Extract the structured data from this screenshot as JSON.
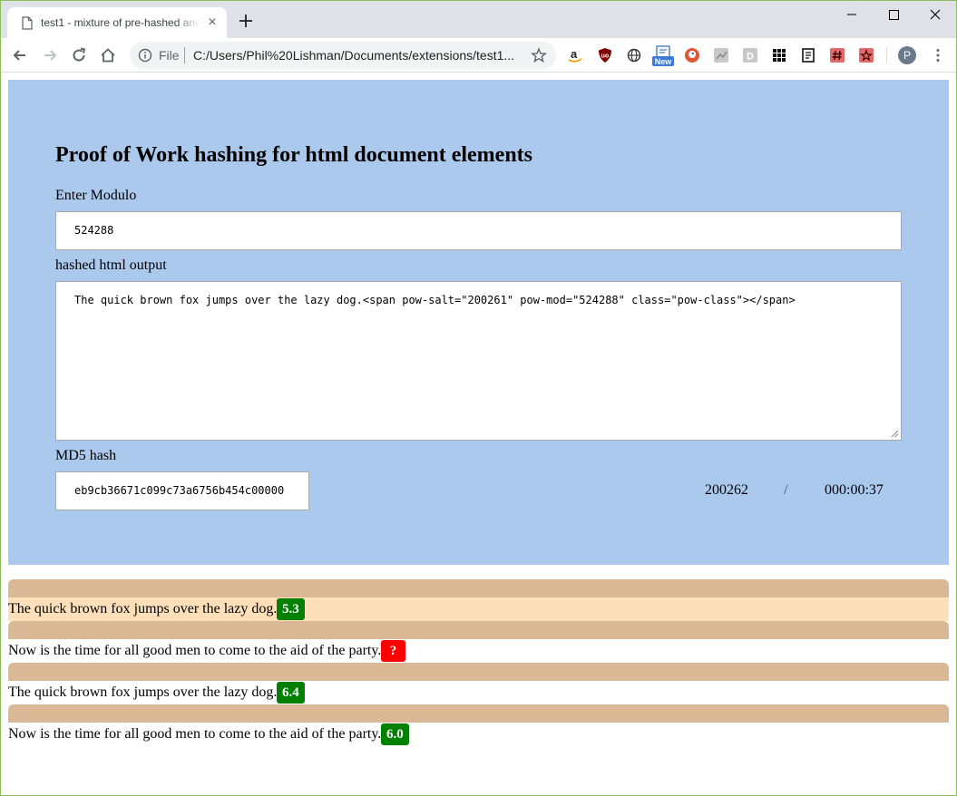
{
  "browser": {
    "tab_title": "test1 - mixture of pre-hashed and",
    "url_scheme": "File",
    "url": "C:/Users/Phil%20Lishman/Documents/extensions/test1...",
    "new_badge": "New",
    "profile_initial": "P"
  },
  "page": {
    "heading": "Proof of Work hashing for html document elements",
    "modulo_label": "Enter Modulo",
    "modulo_value": "524288",
    "hashed_label": "hashed html output",
    "hashed_value": "The quick brown fox jumps over the lazy dog.<span pow-salt=\"200261\" pow-mod=\"524288\" class=\"pow-class\"></span>",
    "md5_label": "MD5 hash",
    "md5_value": "eb9cb36671c099c73a6756b454c00000",
    "counter": "200262",
    "separator": "/",
    "elapsed": "000:00:37"
  },
  "rows": [
    {
      "text": "The quick brown fox jumps over the lazy dog.",
      "score": "5.3",
      "status_color": "#008000"
    },
    {
      "text": "Now is the time for all good men to come to the aid of the party.",
      "score": "?",
      "status_color": "#ff0000"
    },
    {
      "text": "The quick brown fox jumps over the lazy dog.",
      "score": "6.4",
      "status_color": "#008000"
    },
    {
      "text": "Now is the time for all good men to come to the aid of the party.",
      "score": "6.0",
      "status_color": "#008000"
    }
  ],
  "colors": {
    "panel": "#abc9ed",
    "divider": "#dbb895",
    "highlight": "#fde0b9"
  }
}
